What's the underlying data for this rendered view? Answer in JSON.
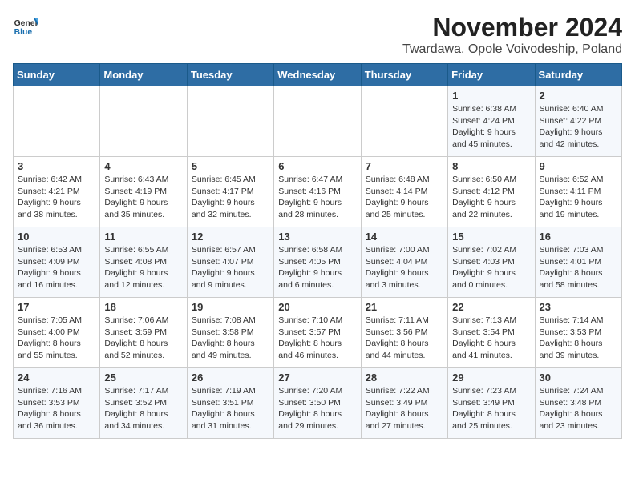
{
  "logo": {
    "general": "General",
    "blue": "Blue"
  },
  "title": "November 2024",
  "subtitle": "Twardawa, Opole Voivodeship, Poland",
  "days_of_week": [
    "Sunday",
    "Monday",
    "Tuesday",
    "Wednesday",
    "Thursday",
    "Friday",
    "Saturday"
  ],
  "weeks": [
    [
      {
        "day": "",
        "detail": ""
      },
      {
        "day": "",
        "detail": ""
      },
      {
        "day": "",
        "detail": ""
      },
      {
        "day": "",
        "detail": ""
      },
      {
        "day": "",
        "detail": ""
      },
      {
        "day": "1",
        "detail": "Sunrise: 6:38 AM\nSunset: 4:24 PM\nDaylight: 9 hours\nand 45 minutes."
      },
      {
        "day": "2",
        "detail": "Sunrise: 6:40 AM\nSunset: 4:22 PM\nDaylight: 9 hours\nand 42 minutes."
      }
    ],
    [
      {
        "day": "3",
        "detail": "Sunrise: 6:42 AM\nSunset: 4:21 PM\nDaylight: 9 hours\nand 38 minutes."
      },
      {
        "day": "4",
        "detail": "Sunrise: 6:43 AM\nSunset: 4:19 PM\nDaylight: 9 hours\nand 35 minutes."
      },
      {
        "day": "5",
        "detail": "Sunrise: 6:45 AM\nSunset: 4:17 PM\nDaylight: 9 hours\nand 32 minutes."
      },
      {
        "day": "6",
        "detail": "Sunrise: 6:47 AM\nSunset: 4:16 PM\nDaylight: 9 hours\nand 28 minutes."
      },
      {
        "day": "7",
        "detail": "Sunrise: 6:48 AM\nSunset: 4:14 PM\nDaylight: 9 hours\nand 25 minutes."
      },
      {
        "day": "8",
        "detail": "Sunrise: 6:50 AM\nSunset: 4:12 PM\nDaylight: 9 hours\nand 22 minutes."
      },
      {
        "day": "9",
        "detail": "Sunrise: 6:52 AM\nSunset: 4:11 PM\nDaylight: 9 hours\nand 19 minutes."
      }
    ],
    [
      {
        "day": "10",
        "detail": "Sunrise: 6:53 AM\nSunset: 4:09 PM\nDaylight: 9 hours\nand 16 minutes."
      },
      {
        "day": "11",
        "detail": "Sunrise: 6:55 AM\nSunset: 4:08 PM\nDaylight: 9 hours\nand 12 minutes."
      },
      {
        "day": "12",
        "detail": "Sunrise: 6:57 AM\nSunset: 4:07 PM\nDaylight: 9 hours\nand 9 minutes."
      },
      {
        "day": "13",
        "detail": "Sunrise: 6:58 AM\nSunset: 4:05 PM\nDaylight: 9 hours\nand 6 minutes."
      },
      {
        "day": "14",
        "detail": "Sunrise: 7:00 AM\nSunset: 4:04 PM\nDaylight: 9 hours\nand 3 minutes."
      },
      {
        "day": "15",
        "detail": "Sunrise: 7:02 AM\nSunset: 4:03 PM\nDaylight: 9 hours\nand 0 minutes."
      },
      {
        "day": "16",
        "detail": "Sunrise: 7:03 AM\nSunset: 4:01 PM\nDaylight: 8 hours\nand 58 minutes."
      }
    ],
    [
      {
        "day": "17",
        "detail": "Sunrise: 7:05 AM\nSunset: 4:00 PM\nDaylight: 8 hours\nand 55 minutes."
      },
      {
        "day": "18",
        "detail": "Sunrise: 7:06 AM\nSunset: 3:59 PM\nDaylight: 8 hours\nand 52 minutes."
      },
      {
        "day": "19",
        "detail": "Sunrise: 7:08 AM\nSunset: 3:58 PM\nDaylight: 8 hours\nand 49 minutes."
      },
      {
        "day": "20",
        "detail": "Sunrise: 7:10 AM\nSunset: 3:57 PM\nDaylight: 8 hours\nand 46 minutes."
      },
      {
        "day": "21",
        "detail": "Sunrise: 7:11 AM\nSunset: 3:56 PM\nDaylight: 8 hours\nand 44 minutes."
      },
      {
        "day": "22",
        "detail": "Sunrise: 7:13 AM\nSunset: 3:54 PM\nDaylight: 8 hours\nand 41 minutes."
      },
      {
        "day": "23",
        "detail": "Sunrise: 7:14 AM\nSunset: 3:53 PM\nDaylight: 8 hours\nand 39 minutes."
      }
    ],
    [
      {
        "day": "24",
        "detail": "Sunrise: 7:16 AM\nSunset: 3:53 PM\nDaylight: 8 hours\nand 36 minutes."
      },
      {
        "day": "25",
        "detail": "Sunrise: 7:17 AM\nSunset: 3:52 PM\nDaylight: 8 hours\nand 34 minutes."
      },
      {
        "day": "26",
        "detail": "Sunrise: 7:19 AM\nSunset: 3:51 PM\nDaylight: 8 hours\nand 31 minutes."
      },
      {
        "day": "27",
        "detail": "Sunrise: 7:20 AM\nSunset: 3:50 PM\nDaylight: 8 hours\nand 29 minutes."
      },
      {
        "day": "28",
        "detail": "Sunrise: 7:22 AM\nSunset: 3:49 PM\nDaylight: 8 hours\nand 27 minutes."
      },
      {
        "day": "29",
        "detail": "Sunrise: 7:23 AM\nSunset: 3:49 PM\nDaylight: 8 hours\nand 25 minutes."
      },
      {
        "day": "30",
        "detail": "Sunrise: 7:24 AM\nSunset: 3:48 PM\nDaylight: 8 hours\nand 23 minutes."
      }
    ]
  ]
}
